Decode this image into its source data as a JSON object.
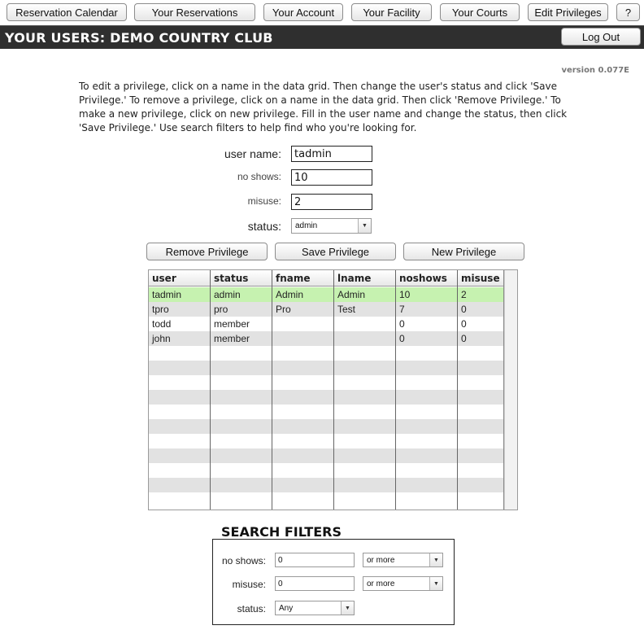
{
  "nav": {
    "reservation_calendar": "Reservation Calendar",
    "your_reservations": "Your Reservations",
    "your_account": "Your Account",
    "your_facility": "Your Facility",
    "your_courts": "Your Courts",
    "edit_privileges": "Edit Privileges",
    "help": "?"
  },
  "header": {
    "title": "YOUR USERS: DEMO COUNTRY CLUB",
    "logout": "Log Out"
  },
  "version": "version 0.077E",
  "instructions": "To edit a privilege, click on a name in the data grid.  Then change the user's status and click 'Save Privilege.' To remove a privilege, click on a name in the data grid.  Then click 'Remove Privilege.'  To make a new privilege, click on new privilege. Fill in the user name and change the status, then click 'Save Privilege.'  Use search filters to help find who you're looking for.",
  "form": {
    "user_name_label": "user name:",
    "user_name_value": "tadmin",
    "no_shows_label": "no shows:",
    "no_shows_value": "10",
    "misuse_label": "misuse:",
    "misuse_value": "2",
    "status_label": "status:",
    "status_value": "admin"
  },
  "actions": {
    "remove": "Remove Privilege",
    "save": "Save Privilege",
    "new": "New Privilege"
  },
  "grid": {
    "columns": [
      "user",
      "status",
      "fname",
      "lname",
      "noshows",
      "misuse"
    ],
    "rows": [
      [
        "tadmin",
        "admin",
        "Admin",
        "Admin",
        "10",
        "2"
      ],
      [
        "tpro",
        "pro",
        "Pro",
        "Test",
        "7",
        "0"
      ],
      [
        "todd",
        "member",
        "",
        "",
        "0",
        "0"
      ],
      [
        "john",
        "member",
        "",
        "",
        "0",
        "0"
      ]
    ],
    "selected_row": 0,
    "colors": {
      "selected": "#c6f2b0",
      "alt": "#e2e2e2"
    }
  },
  "search_filters": {
    "title": "SEARCH FILTERS",
    "no_shows_label": "no shows:",
    "no_shows_value": "0",
    "no_shows_op": "or more",
    "misuse_label": "misuse:",
    "misuse_value": "0",
    "misuse_op": "or more",
    "status_label": "status:",
    "status_value": "Any"
  }
}
